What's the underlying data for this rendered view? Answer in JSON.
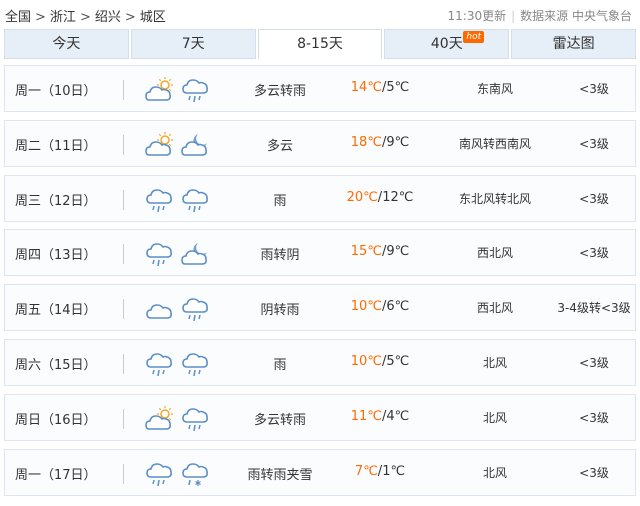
{
  "breadcrumb": [
    "全国",
    "浙江",
    "绍兴",
    "城区"
  ],
  "breadcrumb_separator": ">",
  "update_time": "11:30更新",
  "data_source": "数据来源 中央气象台",
  "tabs": [
    {
      "label": "今天"
    },
    {
      "label": "7天"
    },
    {
      "label": "8-15天",
      "active": true
    },
    {
      "label": "40天",
      "badge": "hot"
    },
    {
      "label": "雷达图"
    }
  ],
  "colors": {
    "accent": "#ff6a00",
    "icon": "#5b8fc7",
    "sun": "#f5a623",
    "tab_bg": "#e6eef7"
  },
  "days": [
    {
      "day": "周一（10日）",
      "icons": [
        "partly-cloudy-icon",
        "rain-icon"
      ],
      "weather": "多云转雨",
      "high": "14℃",
      "low": "5℃",
      "wind": "东南风",
      "level": "<3级"
    },
    {
      "day": "周二（11日）",
      "icons": [
        "partly-cloudy-icon",
        "cloudy-night-icon"
      ],
      "weather": "多云",
      "high": "18℃",
      "low": "9℃",
      "wind": "南风转西南风",
      "level": "<3级"
    },
    {
      "day": "周三（12日）",
      "icons": [
        "rain-icon",
        "rain-icon"
      ],
      "weather": "雨",
      "high": "20℃",
      "low": "12℃",
      "wind": "东北风转北风",
      "level": "<3级"
    },
    {
      "day": "周四（13日）",
      "icons": [
        "rain-icon",
        "cloudy-night-icon"
      ],
      "weather": "雨转阴",
      "high": "15℃",
      "low": "9℃",
      "wind": "西北风",
      "level": "<3级"
    },
    {
      "day": "周五（14日）",
      "icons": [
        "overcast-icon",
        "rain-icon"
      ],
      "weather": "阴转雨",
      "high": "10℃",
      "low": "6℃",
      "wind": "西北风",
      "level": "3-4级转<3级"
    },
    {
      "day": "周六（15日）",
      "icons": [
        "rain-icon",
        "rain-icon"
      ],
      "weather": "雨",
      "high": "10℃",
      "low": "5℃",
      "wind": "北风",
      "level": "<3级"
    },
    {
      "day": "周日（16日）",
      "icons": [
        "partly-cloudy-icon",
        "rain-icon"
      ],
      "weather": "多云转雨",
      "high": "11℃",
      "low": "4℃",
      "wind": "北风",
      "level": "<3级"
    },
    {
      "day": "周一（17日）",
      "icons": [
        "rain-icon",
        "sleet-icon"
      ],
      "weather": "雨转雨夹雪",
      "high": "7℃",
      "low": "1℃",
      "wind": "北风",
      "level": "<3级"
    }
  ]
}
